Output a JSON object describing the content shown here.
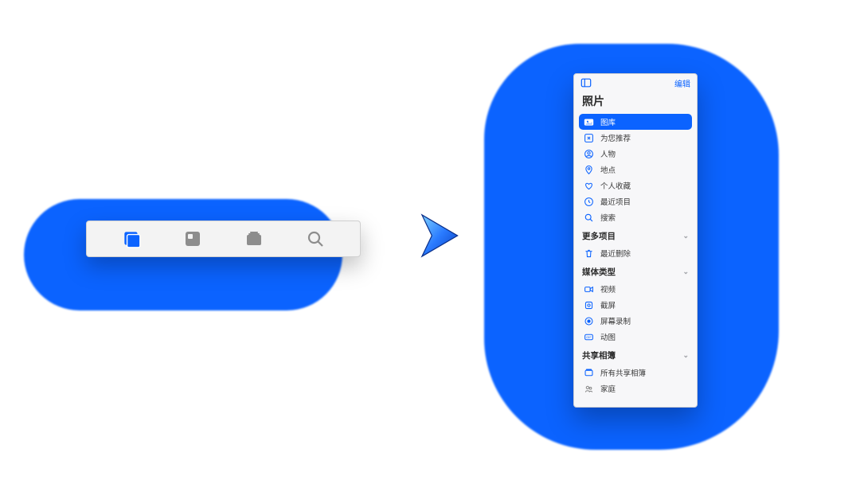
{
  "colors": {
    "accent": "#0b63ff",
    "muted": "#8d8d8d"
  },
  "tabbar": {
    "tabs": [
      {
        "id": "library",
        "icon": "library-icon",
        "active": true
      },
      {
        "id": "for-you",
        "icon": "foryou-icon",
        "active": false
      },
      {
        "id": "albums",
        "icon": "albums-icon",
        "active": false
      },
      {
        "id": "search",
        "icon": "search-icon",
        "active": false
      }
    ]
  },
  "sidebar": {
    "header": {
      "edit_label": "编辑"
    },
    "title": "照片",
    "sections": [
      {
        "title": null,
        "items": [
          {
            "label": "图库",
            "icon": "photos-icon",
            "selected": true
          },
          {
            "label": "为您推荐",
            "icon": "sparkle-icon"
          },
          {
            "label": "人物",
            "icon": "person-icon"
          },
          {
            "label": "地点",
            "icon": "pin-icon"
          },
          {
            "label": "个人收藏",
            "icon": "heart-icon"
          },
          {
            "label": "最近项目",
            "icon": "clock-icon"
          },
          {
            "label": "搜索",
            "icon": "search-mini-icon"
          }
        ]
      },
      {
        "title": "更多项目",
        "items": [
          {
            "label": "最近删除",
            "icon": "trash-icon"
          }
        ]
      },
      {
        "title": "媒体类型",
        "items": [
          {
            "label": "视频",
            "icon": "video-icon"
          },
          {
            "label": "截屏",
            "icon": "screenshot-icon"
          },
          {
            "label": "屏幕录制",
            "icon": "screenrecord-icon"
          },
          {
            "label": "动图",
            "icon": "gif-icon"
          }
        ]
      },
      {
        "title": "共享相簿",
        "items": [
          {
            "label": "所有共享相簿",
            "icon": "album-icon"
          },
          {
            "label": "家庭",
            "icon": "family-icon",
            "muted": true
          }
        ]
      }
    ]
  }
}
